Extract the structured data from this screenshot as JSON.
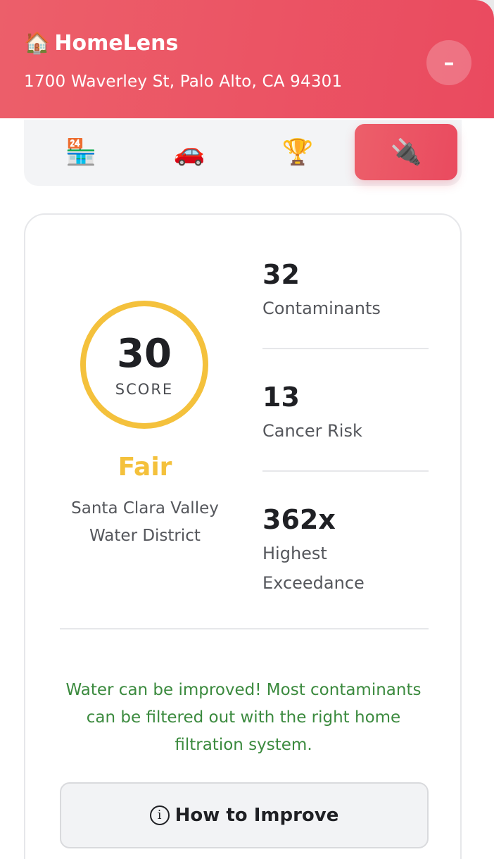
{
  "header": {
    "icon": "🏠",
    "title": "HomeLens",
    "address": "1700 Waverley St, Palo Alto, CA 94301",
    "minimize_label": "–"
  },
  "tabs": [
    {
      "icon": "🏪",
      "name": "convenience-store-icon",
      "active": false
    },
    {
      "icon": "🚗",
      "name": "car-icon",
      "active": false
    },
    {
      "icon": "🏆",
      "name": "trophy-icon",
      "active": false
    },
    {
      "icon": "🔌",
      "name": "plug-icon",
      "active": true
    }
  ],
  "score": {
    "value": "30",
    "label": "SCORE",
    "rating": "Fair",
    "district": "Santa Clara Valley Water District"
  },
  "stats": [
    {
      "value": "32",
      "label": "Contaminants"
    },
    {
      "value": "13",
      "label": "Cancer Risk"
    },
    {
      "value": "362x",
      "label": "Highest Exceedance"
    }
  ],
  "message": "Water can be improved! Most contaminants can be filtered out with the right home filtration system.",
  "button": {
    "icon": "i",
    "label": "How to Improve"
  },
  "colors": {
    "brand": "#ea4a5f",
    "rating": "#f4c13c",
    "message": "#3b8a3e"
  }
}
